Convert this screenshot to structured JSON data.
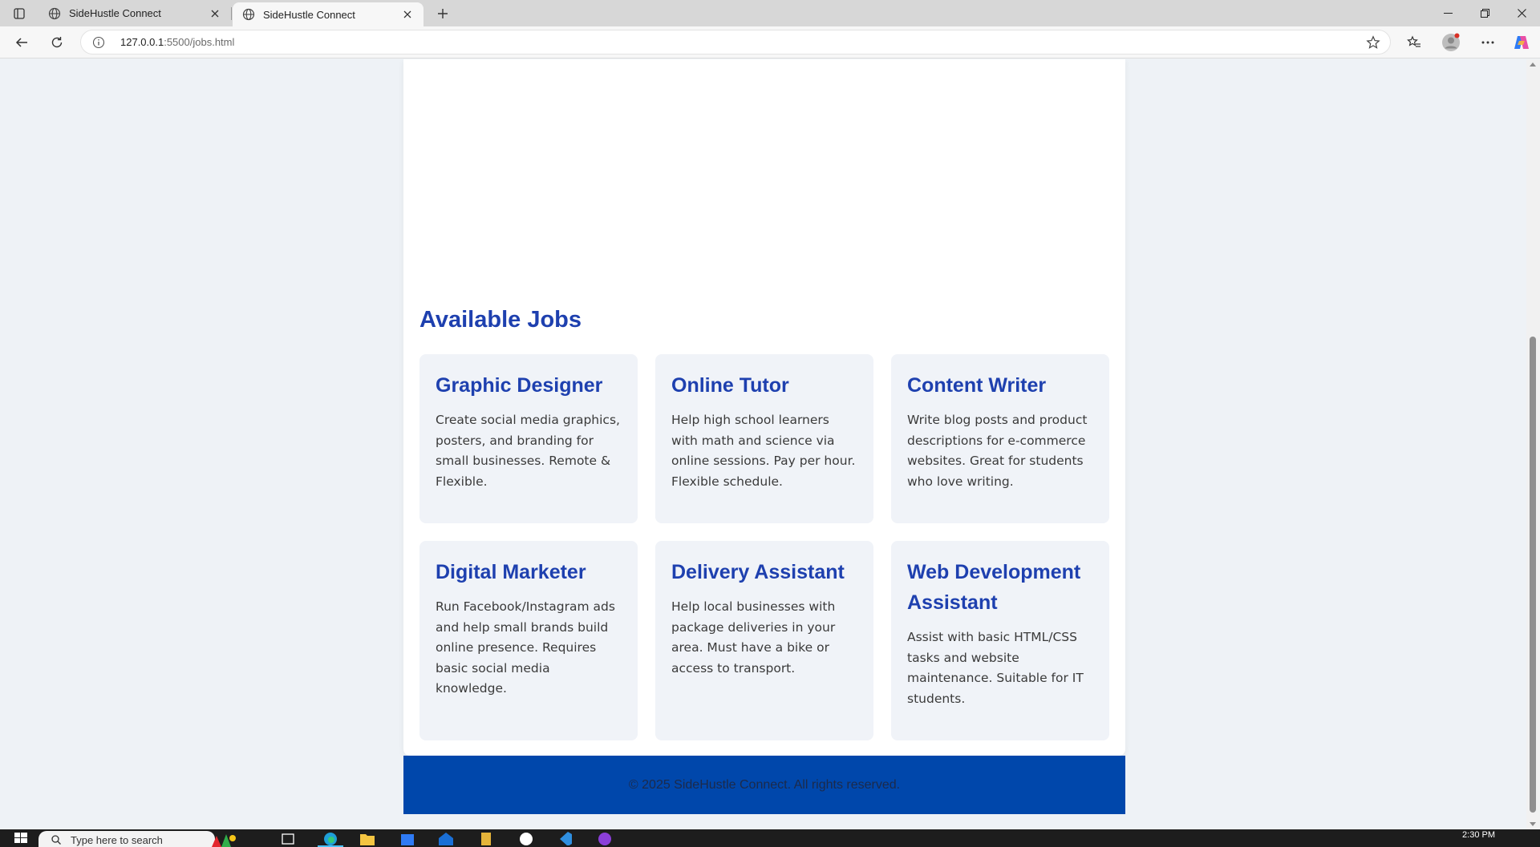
{
  "browser": {
    "tabs": [
      {
        "title": "SideHustle Connect",
        "active": false
      },
      {
        "title": "SideHustle Connect",
        "active": true
      }
    ],
    "url_host": "127.0.0.1",
    "url_path": ":5500/jobs.html"
  },
  "page": {
    "section_title": "Available Jobs",
    "jobs": [
      {
        "title": "Graphic Designer",
        "description": "Create social media graphics, posters, and branding for small businesses. Remote & Flexible."
      },
      {
        "title": "Online Tutor",
        "description": "Help high school learners with math and science via online sessions. Pay per hour. Flexible schedule."
      },
      {
        "title": "Content Writer",
        "description": "Write blog posts and product descriptions for e-commerce websites. Great for students who love writing."
      },
      {
        "title": "Digital Marketer",
        "description": "Run Facebook/Instagram ads and help small brands build online presence. Requires basic social media knowledge."
      },
      {
        "title": "Delivery Assistant",
        "description": "Help local businesses with package deliveries in your area. Must have a bike or access to transport."
      },
      {
        "title": "Web Development Assistant",
        "description": "Assist with basic HTML/CSS tasks and website maintenance. Suitable for IT students."
      }
    ],
    "footer_text": "© 2025 SideHustle Connect. All rights reserved."
  },
  "taskbar": {
    "search_placeholder": "Type here to search",
    "clock": "2:30 PM"
  },
  "colors": {
    "heading_blue": "#1e40af",
    "footer_blue": "#0047ab",
    "card_bg": "#f0f3f8",
    "page_bg": "#eef2f6"
  }
}
